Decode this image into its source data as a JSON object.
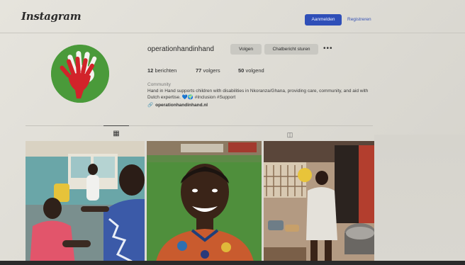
{
  "header": {
    "logo_text": "Instagram",
    "login_label": "Aanmelden",
    "register_label": "Registreren"
  },
  "profile": {
    "username": "operationhandinhand",
    "follow_label": "Volgen",
    "message_label": "Chatbericht sturen",
    "more_icon": "more-dots-icon",
    "stats": {
      "posts_count": "12",
      "posts_label": "berichten",
      "followers_count": "77",
      "followers_label": "volgers",
      "following_count": "50",
      "following_label": "volgend"
    },
    "category": "Community",
    "bio": "Hand in Hand supports children with disabilities in Nkoranza/Ghana, providing care, community, and aid with Dutch expertise. 💙🌍 #Inclusion #Support",
    "link": "operationhandinhand.nl"
  },
  "tabs": {
    "grid_icon": "grid-icon",
    "tagged_icon": "tagged-icon"
  },
  "colors": {
    "accent": "#2f4fb8",
    "avatar_green": "#4a9a3a",
    "hand_red": "#d2232a"
  }
}
